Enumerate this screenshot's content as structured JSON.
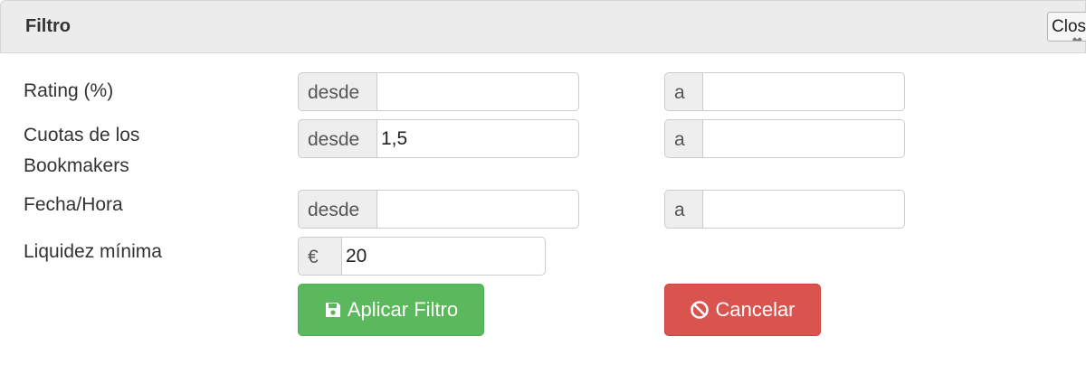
{
  "dialog": {
    "title": "Filtro",
    "close_label": "Close",
    "close_icon": "close-icon"
  },
  "rows": [
    {
      "label": "Rating (%)",
      "from_addon": "desde",
      "from_value": "",
      "to_addon": "a",
      "to_value": ""
    },
    {
      "label": "Cuotas de los Bookmakers",
      "from_addon": "desde",
      "from_value": "1,5",
      "to_addon": "a",
      "to_value": ""
    },
    {
      "label": "Fecha/Hora",
      "from_addon": "desde",
      "from_value": "",
      "to_addon": "a",
      "to_value": ""
    }
  ],
  "liquidity": {
    "label": "Liquidez mínima",
    "addon": "€",
    "value": "20"
  },
  "buttons": {
    "apply_label": "Aplicar Filtro",
    "apply_icon": "floppy-disk-icon",
    "apply_color": "#5cb85c",
    "cancel_label": "Cancelar",
    "cancel_icon": "ban-icon",
    "cancel_color": "#d9534f"
  }
}
